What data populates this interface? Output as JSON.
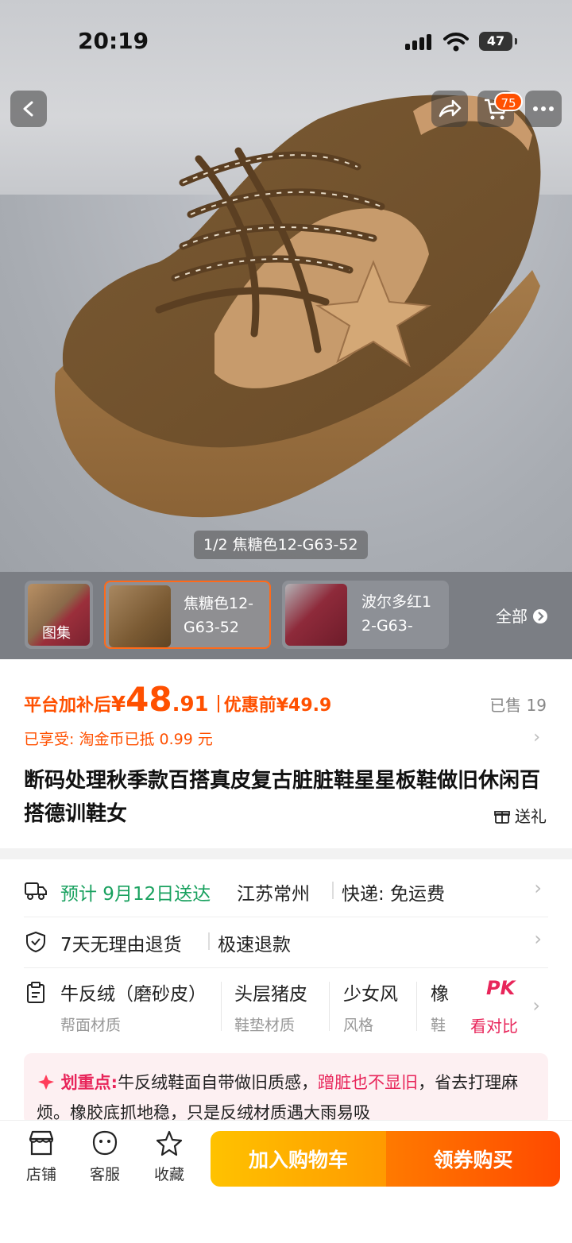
{
  "status_bar": {
    "time": "20:19",
    "battery": "47"
  },
  "header": {
    "cart_count": "75"
  },
  "gallery": {
    "counter": "1/2 焦糖色12-G63-52"
  },
  "variants": [
    {
      "label": "图集"
    },
    {
      "label": "焦糖色12-G63-52"
    },
    {
      "label": "波尔多红12-G63-"
    }
  ],
  "variants_all": "全部",
  "price": {
    "prefix": "平台加补后",
    "currency": "¥",
    "int": "48",
    "dec": ".91",
    "before_label": "优惠前¥49.9",
    "sold": "已售 19"
  },
  "discount": {
    "label": "已享受:",
    "text": "淘金币已抵 0.99 元"
  },
  "product": {
    "title": "断码处理秋季款百搭真皮复古脏脏鞋星星板鞋做旧休闲百搭德训鞋女",
    "gift": "送礼"
  },
  "delivery": {
    "eta": "预计 9月12日送达",
    "origin": "江苏常州",
    "shipping": "快递: 免运费"
  },
  "returns": {
    "policy": "7天无理由退货",
    "refund": "极速退款"
  },
  "attributes": [
    {
      "value": "牛反绒（磨砂皮）",
      "key": "帮面材质"
    },
    {
      "value": "头层猪皮",
      "key": "鞋垫材质"
    },
    {
      "value": "少女风",
      "key": "风格"
    },
    {
      "value": "橡",
      "key": "鞋"
    }
  ],
  "compare": {
    "badge": "PK",
    "label": "看对比"
  },
  "highlight": {
    "title": "划重点:",
    "text_1": "牛反绒鞋面自带做旧质感，",
    "emphasis": "蹭脏也不显旧",
    "text_2": "，省去打理麻烦。橡胶底抓地稳，只是反绒材质遇大雨易吸"
  },
  "bottom_bar": {
    "store": "店铺",
    "service": "客服",
    "favorite": "收藏",
    "add_cart": "加入购物车",
    "buy": "领券购买"
  },
  "colors": {
    "brand_orange": "#ff5000",
    "green": "#19a15f",
    "cta_left": "#ffb200",
    "cta_right": "#ff5000"
  }
}
